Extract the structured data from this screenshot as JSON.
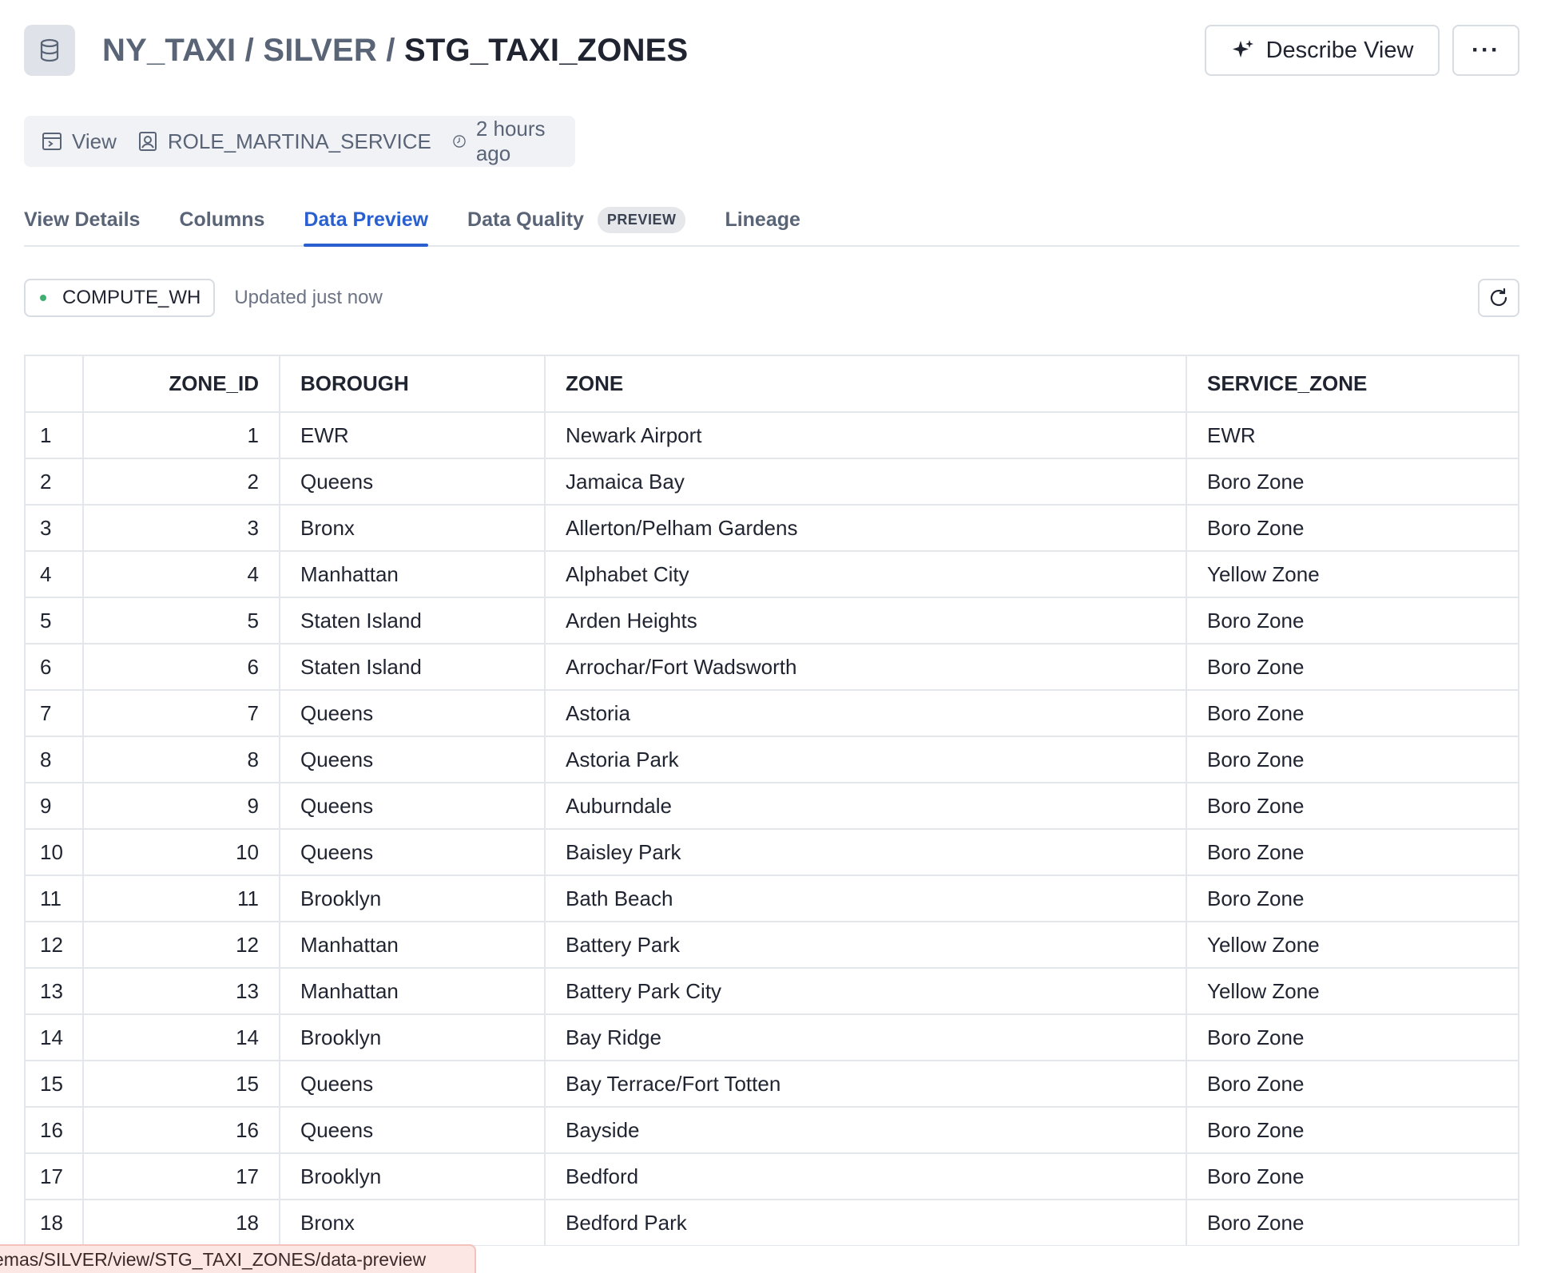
{
  "header": {
    "breadcrumb_db": "NY_TAXI",
    "breadcrumb_sep1": " / ",
    "breadcrumb_schema": "SILVER",
    "breadcrumb_sep2": " / ",
    "breadcrumb_view": "STG_TAXI_ZONES",
    "describe_label": "Describe View",
    "more_label": "···"
  },
  "meta": {
    "type": "View",
    "owner": "ROLE_MARTINA_SERVICE",
    "modified": "2 hours ago"
  },
  "tabs": [
    {
      "label": "View Details"
    },
    {
      "label": "Columns"
    },
    {
      "label": "Data Preview",
      "active": true
    },
    {
      "label": "Data Quality",
      "badge": "PREVIEW"
    },
    {
      "label": "Lineage"
    }
  ],
  "toolbar": {
    "warehouse": "COMPUTE_WH",
    "updated": "Updated just now"
  },
  "table": {
    "columns": [
      "",
      "ZONE_ID",
      "BOROUGH",
      "ZONE",
      "SERVICE_ZONE"
    ],
    "rows": [
      [
        "1",
        "1",
        "EWR",
        "Newark Airport",
        "EWR"
      ],
      [
        "2",
        "2",
        "Queens",
        "Jamaica Bay",
        "Boro Zone"
      ],
      [
        "3",
        "3",
        "Bronx",
        "Allerton/Pelham Gardens",
        "Boro Zone"
      ],
      [
        "4",
        "4",
        "Manhattan",
        "Alphabet City",
        "Yellow Zone"
      ],
      [
        "5",
        "5",
        "Staten Island",
        "Arden Heights",
        "Boro Zone"
      ],
      [
        "6",
        "6",
        "Staten Island",
        "Arrochar/Fort Wadsworth",
        "Boro Zone"
      ],
      [
        "7",
        "7",
        "Queens",
        "Astoria",
        "Boro Zone"
      ],
      [
        "8",
        "8",
        "Queens",
        "Astoria Park",
        "Boro Zone"
      ],
      [
        "9",
        "9",
        "Queens",
        "Auburndale",
        "Boro Zone"
      ],
      [
        "10",
        "10",
        "Queens",
        "Baisley Park",
        "Boro Zone"
      ],
      [
        "11",
        "11",
        "Brooklyn",
        "Bath Beach",
        "Boro Zone"
      ],
      [
        "12",
        "12",
        "Manhattan",
        "Battery Park",
        "Yellow Zone"
      ],
      [
        "13",
        "13",
        "Manhattan",
        "Battery Park City",
        "Yellow Zone"
      ],
      [
        "14",
        "14",
        "Brooklyn",
        "Bay Ridge",
        "Boro Zone"
      ],
      [
        "15",
        "15",
        "Queens",
        "Bay Terrace/Fort Totten",
        "Boro Zone"
      ],
      [
        "16",
        "16",
        "Queens",
        "Bayside",
        "Boro Zone"
      ],
      [
        "17",
        "17",
        "Brooklyn",
        "Bedford",
        "Boro Zone"
      ],
      [
        "18",
        "18",
        "Bronx",
        "Bedford Park",
        "Boro Zone"
      ]
    ]
  },
  "status_url": "emas/SILVER/view/STG_TAXI_ZONES/data-preview",
  "colors": {
    "accent": "#2a5fd0",
    "warehouse_dot": "#3fae6f"
  }
}
